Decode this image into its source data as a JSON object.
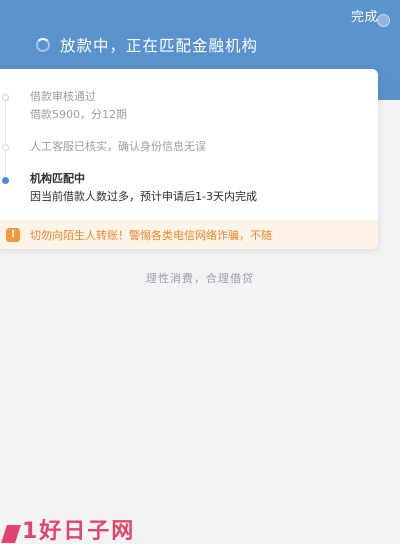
{
  "header": {
    "done_label": "完成",
    "status_text": "放款中，正在匹配金融机构"
  },
  "timeline": {
    "steps": [
      {
        "title": "借款审核通过",
        "subtitle": "借款5900，分12期",
        "state": "done"
      },
      {
        "title": "人工客服已核实，确认身份信息无误",
        "subtitle": "",
        "state": "done"
      },
      {
        "title": "机构匹配中",
        "subtitle": "因当前借款人数过多，预计申请后1-3天内完成",
        "state": "current"
      }
    ]
  },
  "warning": {
    "icon": "shield-icon",
    "text": "切勿向陌生人转账！警惕各类电信网络诈骗，不随"
  },
  "slogan": "理性消费，合理借贷",
  "watermark": {
    "text": "1好日子网"
  },
  "colors": {
    "header_bg": "#5a91cd",
    "accent_blue": "#4a8be0",
    "warning_bg": "#fdf3e7",
    "warning_text": "#e98a2b",
    "watermark": "#e0466c"
  }
}
